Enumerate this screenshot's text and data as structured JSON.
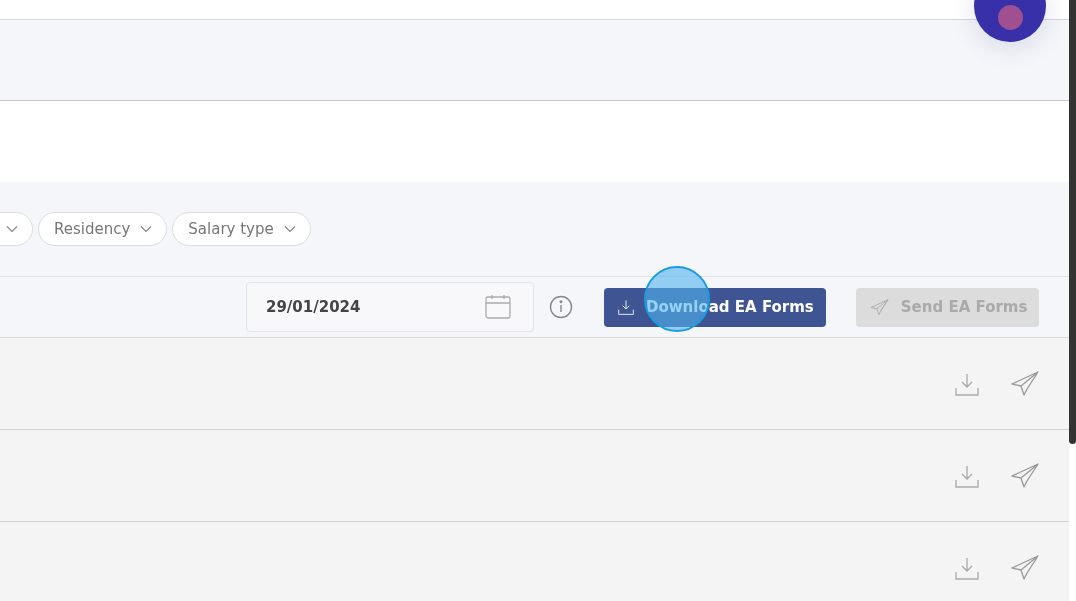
{
  "filter_bar": {
    "leading_chip_cut": true,
    "filters": [
      {
        "label": "Residency"
      },
      {
        "label": "Salary type"
      }
    ]
  },
  "toolbar": {
    "date": {
      "value": "29/01/2024"
    },
    "buttons": [
      {
        "label": "Download EA Forms",
        "disabled": false
      },
      {
        "label": "Send EA Forms",
        "disabled": true
      }
    ]
  },
  "rows": [
    {
      "actions": [
        {
          "kind": "download"
        },
        {
          "kind": "send"
        }
      ]
    },
    {
      "actions": [
        {
          "kind": "download"
        },
        {
          "kind": "send"
        }
      ]
    },
    {
      "actions": [
        {
          "kind": "download"
        },
        {
          "kind": "send"
        }
      ]
    }
  ]
}
